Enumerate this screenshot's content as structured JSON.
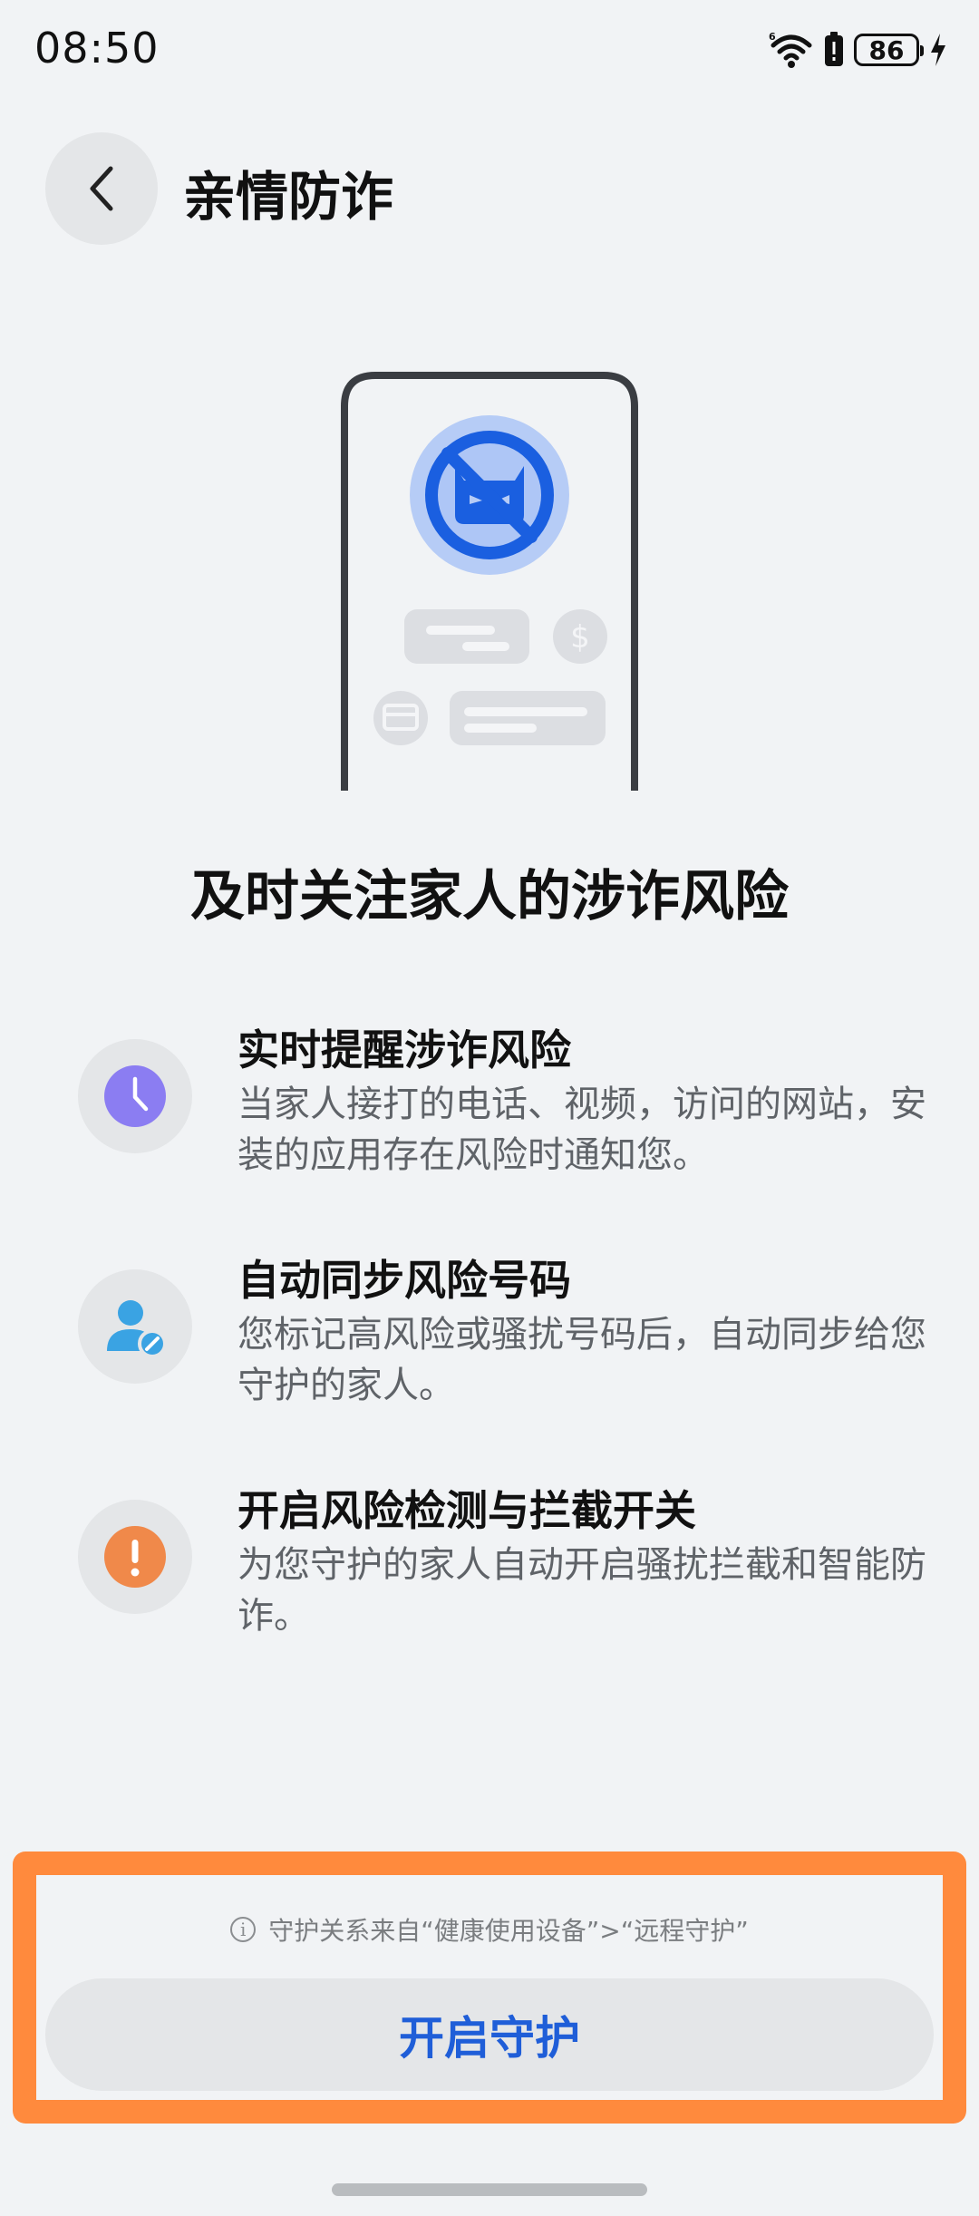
{
  "status_bar": {
    "time": "08:50",
    "battery_level": "86"
  },
  "header": {
    "title": "亲情防诈"
  },
  "headline": "及时关注家人的涉诈风险",
  "features": [
    {
      "title": "实时提醒涉诈风险",
      "description": "当家人接打的电话、视频，访问的网站，安装的应用存在风险时通知您。",
      "icon": "clock-icon",
      "color": "#8b7df2"
    },
    {
      "title": "自动同步风险号码",
      "description": "您标记高风险或骚扰号码后，自动同步给您守护的家人。",
      "icon": "user-sync-icon",
      "color": "#3aa3e3"
    },
    {
      "title": "开启风险检测与拦截开关",
      "description": "为您守护的家人自动开启骚扰拦截和智能防诈。",
      "icon": "warning-icon",
      "color": "#f0894a"
    }
  ],
  "bottom": {
    "notice": "守护关系来自“健康使用设备”>“远程守护”",
    "button_label": "开启守护"
  },
  "colors": {
    "accent_blue": "#1f5ed8",
    "highlight_orange": "#ff8a3d",
    "background": "#f1f3f5"
  }
}
